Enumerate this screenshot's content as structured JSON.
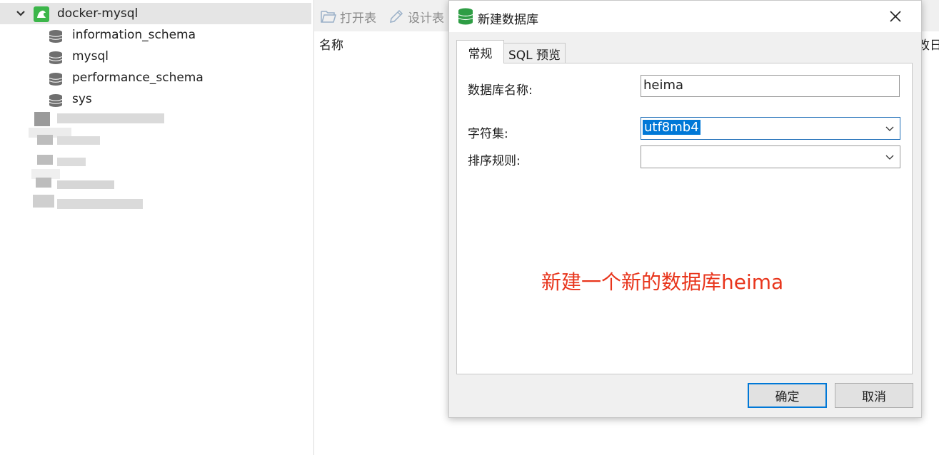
{
  "sidebar": {
    "connection": {
      "name": "docker-mysql"
    },
    "databases": [
      {
        "name": "information_schema"
      },
      {
        "name": "mysql"
      },
      {
        "name": "performance_schema"
      },
      {
        "name": "sys"
      }
    ]
  },
  "toolbar": {
    "open_table": "打开表",
    "design_table": "设计表"
  },
  "table_header": {
    "name_col": "名称",
    "right_col_partial": "改日期"
  },
  "dialog": {
    "title": "新建数据库",
    "tabs": [
      {
        "label": "常规",
        "active": true
      },
      {
        "label": "SQL 预览",
        "active": false
      }
    ],
    "fields": {
      "db_name_label": "数据库名称:",
      "db_name_value": "heima",
      "charset_label": "字符集:",
      "charset_value": "utf8mb4",
      "collation_label": "排序规则:",
      "collation_value": ""
    },
    "annotation": "新建一个新的数据库heima",
    "ok_label": "确定",
    "cancel_label": "取消"
  },
  "colors": {
    "connection_icon": "#3cb64a",
    "annotation": "#e8351c",
    "selection": "#0078d7"
  }
}
